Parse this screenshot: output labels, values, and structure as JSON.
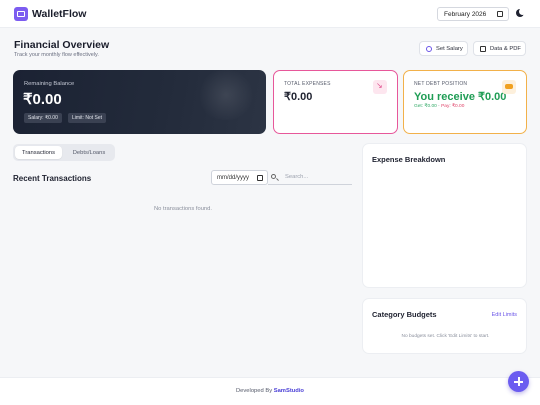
{
  "header": {
    "brand": "WalletFlow",
    "month": "February 2026"
  },
  "overview": {
    "title": "Financial Overview",
    "subtitle": "Track your monthly flow effectively.",
    "set_salary_label": "Set Salary",
    "data_pdf_label": "Data & PDF"
  },
  "balance_card": {
    "label": "Remaining Balance",
    "value": "₹0.00",
    "salary_chip": "Salary: ₹0.00",
    "limit_chip": "Limit: Not Set"
  },
  "expense_card": {
    "label": "TOTAL EXPENSES",
    "value": "₹0.00"
  },
  "debt_card": {
    "label": "NET DEBT POSITION",
    "value": "You receive ₹0.00",
    "owed": "Get: ₹0.00",
    "pay": "Pay: ₹0.00"
  },
  "tabs": [
    {
      "label": "Transactions",
      "active": true
    },
    {
      "label": "Debts/Loans",
      "active": false
    }
  ],
  "transactions": {
    "title": "Recent Transactions",
    "date_placeholder": "mm/dd/yyyy",
    "search_placeholder": "Search...",
    "empty_text": "No transactions found."
  },
  "expense_breakdown": {
    "title": "Expense Breakdown"
  },
  "budgets": {
    "title": "Category Budgets",
    "edit_label": "Edit Limits",
    "empty_text": "No budgets set. Click 'Edit Limits' to start."
  },
  "footer": {
    "prefix": "Developed By ",
    "studio": "SamStudio"
  },
  "colors": {
    "accent": "#6b5cf0",
    "expense_border": "#e7579a",
    "debt_border": "#f2b14a",
    "positive": "#1f9d55"
  }
}
